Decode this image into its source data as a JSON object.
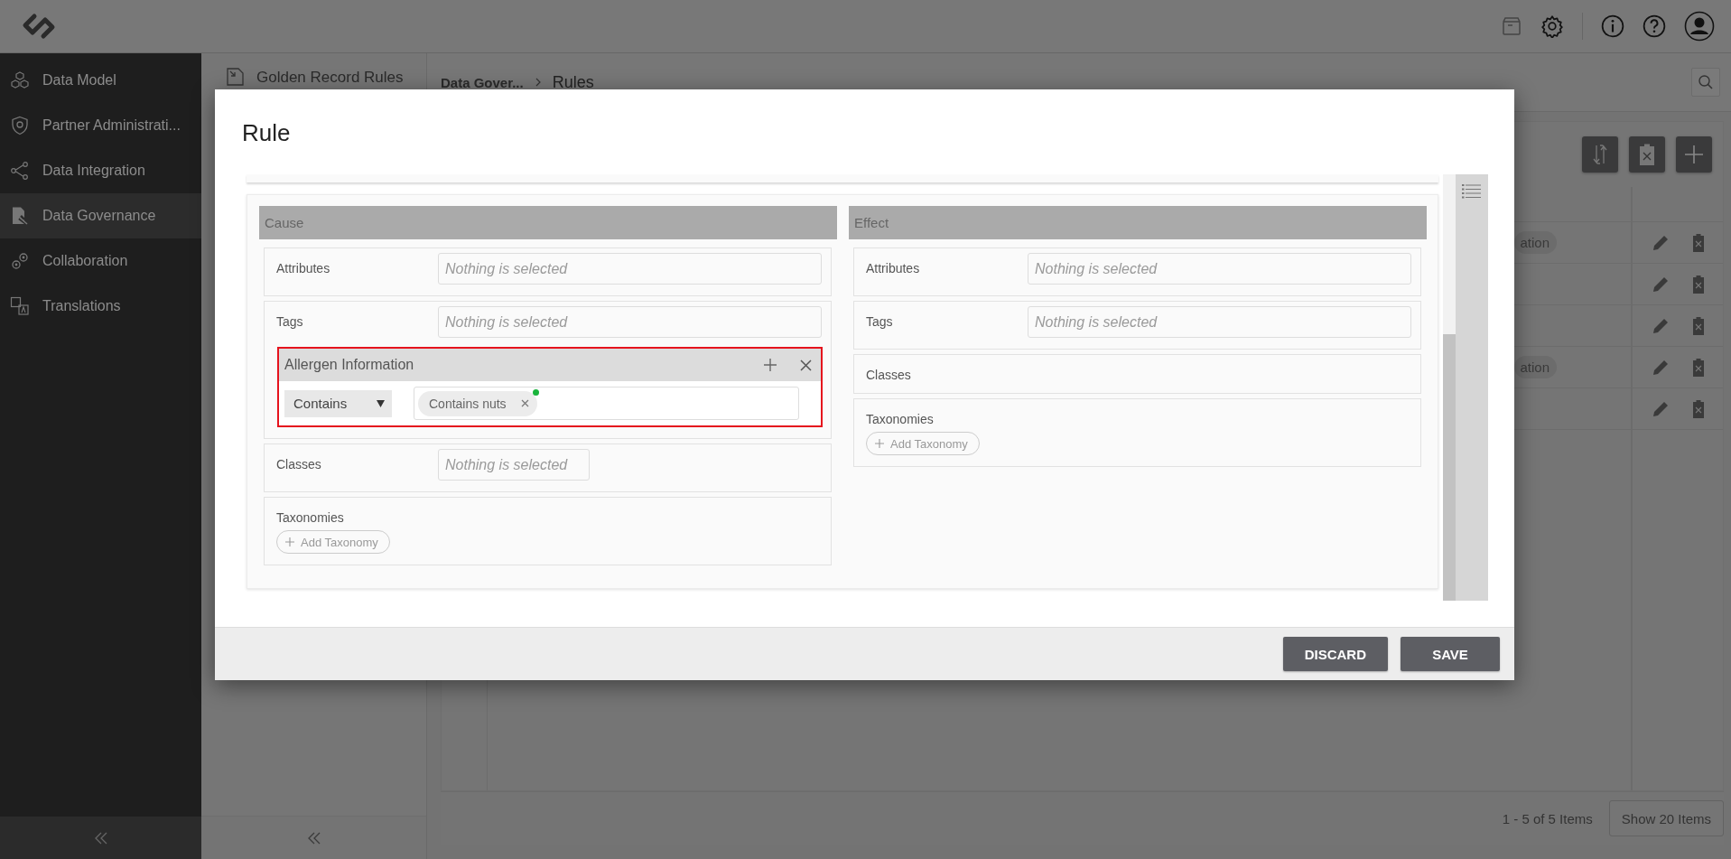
{
  "sidebar": {
    "items": [
      {
        "label": "Data Model",
        "selected": false
      },
      {
        "label": "Partner Administrati...",
        "selected": false
      },
      {
        "label": "Data Integration",
        "selected": false
      },
      {
        "label": "Data Governance",
        "selected": true
      },
      {
        "label": "Collaboration",
        "selected": false
      },
      {
        "label": "Translations",
        "selected": false
      }
    ]
  },
  "subpanel": {
    "title": "Golden Record Rules"
  },
  "breadcrumb": [
    {
      "label": "Data Gover..."
    },
    {
      "label": "Rules"
    }
  ],
  "table": {
    "rows": [
      {
        "tag": "ation"
      },
      {},
      {},
      {
        "tag": "ation"
      },
      {}
    ]
  },
  "pager": {
    "summary": "1 - 5 of 5 Items",
    "page_size": "Show 20 Items"
  },
  "dialog": {
    "title": "Rule",
    "sections": [
      {
        "title": "Cause",
        "fields": [
          {
            "kind": "select",
            "label": "Attributes",
            "placeholder": "Nothing is selected"
          },
          {
            "kind": "select",
            "label": "Tags",
            "placeholder": "Nothing is selected",
            "condition": {
              "title": "Allergen Information",
              "highlighted": true,
              "operator": "Contains",
              "values": [
                {
                  "label": "Contains nuts",
                  "new": true
                }
              ]
            }
          },
          {
            "kind": "select_short",
            "label": "Classes",
            "placeholder": "Nothing is selected"
          },
          {
            "kind": "taxonomy",
            "label": "Taxonomies",
            "button": "Add Taxonomy"
          }
        ]
      },
      {
        "title": "Effect",
        "fields": [
          {
            "kind": "select",
            "label": "Attributes",
            "placeholder": "Nothing is selected"
          },
          {
            "kind": "select",
            "label": "Tags",
            "placeholder": "Nothing is selected"
          },
          {
            "kind": "label",
            "label": "Classes"
          },
          {
            "kind": "taxonomy",
            "label": "Taxonomies",
            "button": "Add Taxonomy"
          }
        ]
      }
    ],
    "buttons": [
      "DISCARD",
      "SAVE"
    ]
  }
}
